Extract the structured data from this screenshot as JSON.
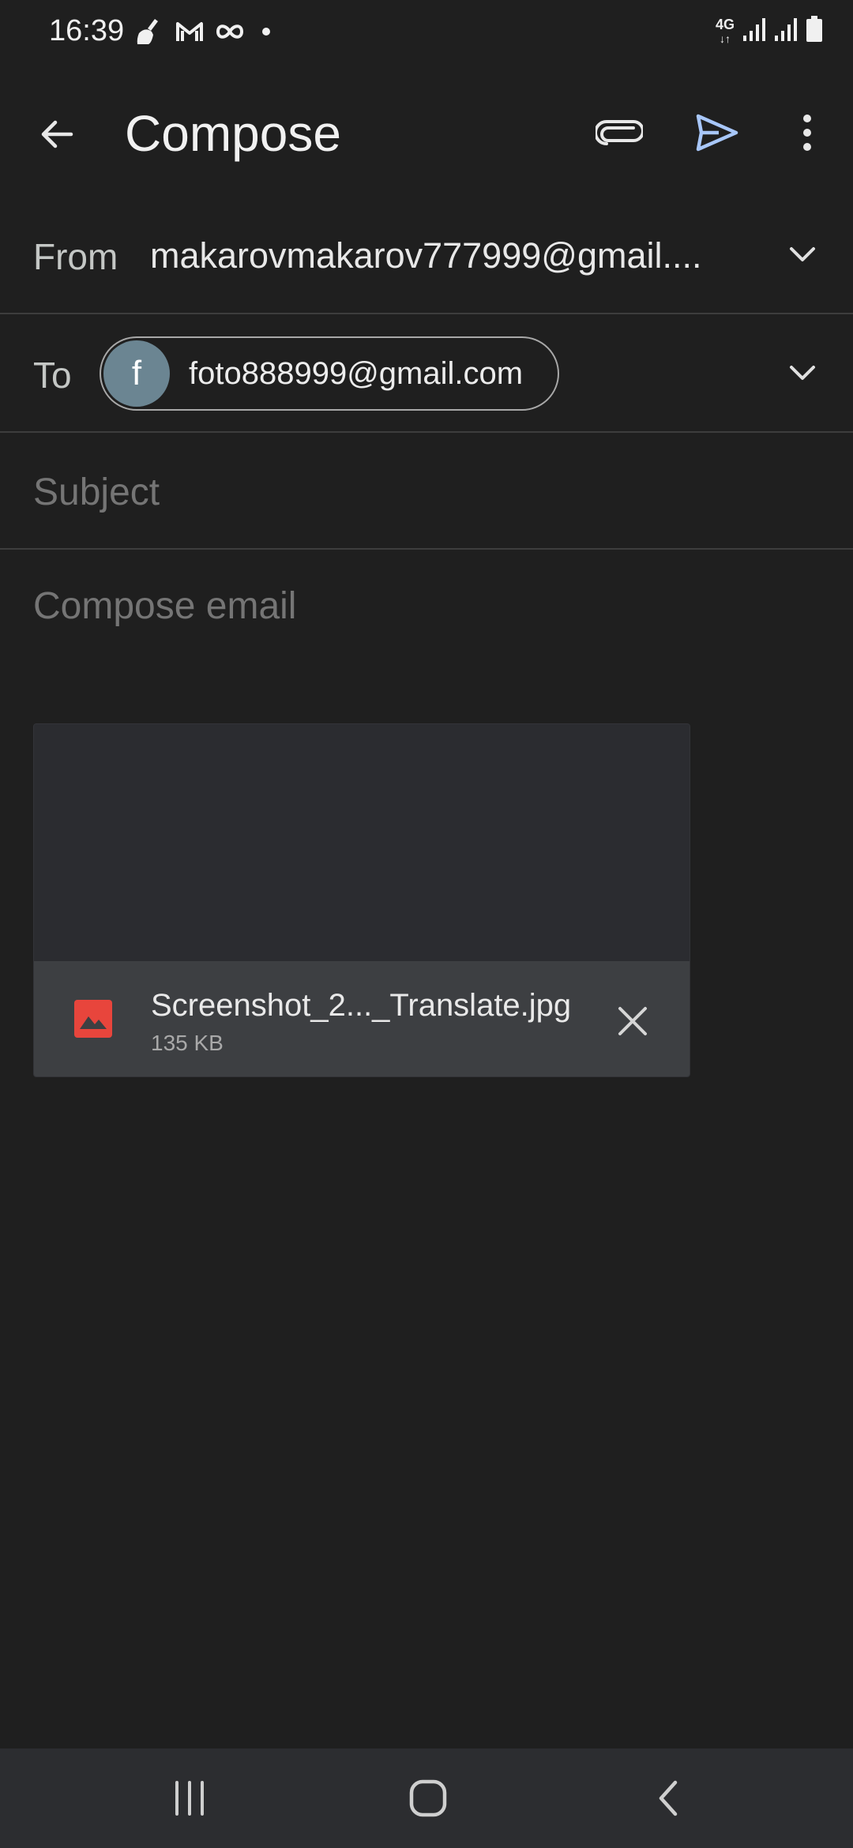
{
  "status_bar": {
    "time": "16:39",
    "network": "4G",
    "icons_left": [
      "broom-icon",
      "gmail-icon",
      "infinity-icon",
      "notification-dot"
    ],
    "icons_right": [
      "network-4g-icon",
      "signal-icon",
      "signal-icon",
      "battery-icon"
    ]
  },
  "app_bar": {
    "title": "Compose",
    "accent_color": "#a8c7fa"
  },
  "from": {
    "label": "From",
    "value": "makarovmakarov777999@gmail...."
  },
  "to": {
    "label": "To",
    "recipient": {
      "initial": "f",
      "email": "foto888999@gmail.com",
      "avatar_color": "#6b8592"
    }
  },
  "subject": {
    "placeholder": "Subject"
  },
  "body": {
    "placeholder": "Compose email"
  },
  "attachment": {
    "file_name": "Screenshot_2..._Translate.jpg",
    "size": "135 KB",
    "icon_color": "#e8453c"
  }
}
